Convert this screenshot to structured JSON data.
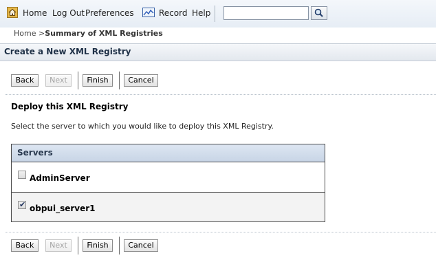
{
  "toolbar": {
    "home": "Home",
    "logout": "Log Out",
    "preferences": "Preferences",
    "record": "Record",
    "help": "Help",
    "search_value": "",
    "icons": {
      "home": "home-icon",
      "record": "record-icon",
      "search": "search-icon"
    }
  },
  "breadcrumb": {
    "home": "Home",
    "separator": ">",
    "current": "Summary of XML Registries"
  },
  "panel": {
    "title": "Create a New XML Registry"
  },
  "buttons": {
    "back": "Back",
    "next": "Next",
    "finish": "Finish",
    "cancel": "Cancel"
  },
  "deploy": {
    "title": "Deploy this XML Registry",
    "description": "Select the server to which you would like to deploy this XML Registry."
  },
  "servers": {
    "header": "Servers",
    "rows": [
      {
        "name": "AdminServer",
        "checked": false
      },
      {
        "name": "obpui_server1",
        "checked": true
      }
    ]
  },
  "colors": {
    "header_blue": "#c8d5e6",
    "accent_navy": "#1f3147"
  }
}
